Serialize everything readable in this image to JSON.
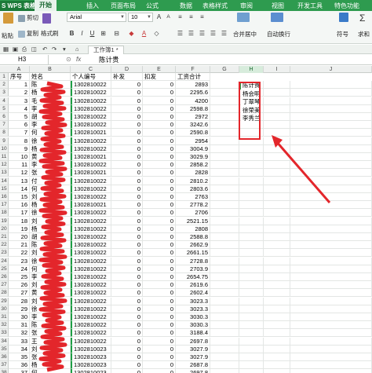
{
  "menubar": {
    "app_name": "S WPS 表格",
    "tabs": [
      "开始",
      "插入",
      "页面布局",
      "公式",
      "数据",
      "表格样式",
      "审阅",
      "视图",
      "开发工具",
      "特色功能"
    ],
    "active_tab": "开始"
  },
  "ribbon": {
    "cut": "剪切",
    "paste": "粘贴",
    "copy": "复制",
    "format_painter": "格式刷",
    "font_name": "Arial",
    "font_size": "10",
    "merge": "合并居中",
    "wrap": "自动换行",
    "symbol": "符号",
    "sum": "求和"
  },
  "tabbar": {
    "doc_tab": "工作簿1 *"
  },
  "formula_bar": {
    "name_box": "H3",
    "fx": "fx",
    "value": "陈计贵"
  },
  "columns": [
    "A",
    "B",
    "C",
    "D",
    "E",
    "F",
    "G",
    "H",
    "I",
    "J"
  ],
  "selected_column": "H",
  "header_row": {
    "row": "1",
    "cells": [
      "序号",
      "姓名",
      "个人编号",
      "补发",
      "扣发",
      "工资合计"
    ]
  },
  "rows": [
    {
      "r": "2",
      "a": "1",
      "b": "陈",
      "c": "1302810022",
      "d": "0",
      "e": "0",
      "f": "2893"
    },
    {
      "r": "3",
      "a": "2",
      "b": "杨",
      "c": "1302810022",
      "d": "0",
      "e": "0",
      "f": "2295.6"
    },
    {
      "r": "4",
      "a": "3",
      "b": "毛",
      "c": "1302810022",
      "d": "0",
      "e": "0",
      "f": "4200"
    },
    {
      "r": "5",
      "a": "4",
      "b": "李",
      "c": "1302810022",
      "d": "0",
      "e": "0",
      "f": "2598.8"
    },
    {
      "r": "6",
      "a": "5",
      "b": "胡",
      "c": "1302810022",
      "d": "0",
      "e": "0",
      "f": "2972"
    },
    {
      "r": "7",
      "a": "6",
      "b": "李",
      "c": "1302810022",
      "d": "0",
      "e": "0",
      "f": "3242.6"
    },
    {
      "r": "8",
      "a": "7",
      "b": "何",
      "c": "1302810021",
      "d": "0",
      "e": "0",
      "f": "2590.8"
    },
    {
      "r": "9",
      "a": "8",
      "b": "徐",
      "c": "1302810022",
      "d": "0",
      "e": "0",
      "f": "2954"
    },
    {
      "r": "10",
      "a": "9",
      "b": "杨",
      "c": "1302810022",
      "d": "0",
      "e": "0",
      "f": "3004.9"
    },
    {
      "r": "11",
      "a": "10",
      "b": "黄",
      "c": "1302810021",
      "d": "0",
      "e": "0",
      "f": "3029.9"
    },
    {
      "r": "12",
      "a": "11",
      "b": "李",
      "c": "1302810022",
      "d": "0",
      "e": "0",
      "f": "2858.2"
    },
    {
      "r": "13",
      "a": "12",
      "b": "张",
      "c": "1302810021",
      "d": "0",
      "e": "0",
      "f": "2828"
    },
    {
      "r": "14",
      "a": "13",
      "b": "付",
      "c": "1302810022",
      "d": "0",
      "e": "0",
      "f": "2810.2"
    },
    {
      "r": "15",
      "a": "14",
      "b": "何",
      "c": "1302810022",
      "d": "0",
      "e": "0",
      "f": "2803.6"
    },
    {
      "r": "16",
      "a": "15",
      "b": "刘",
      "c": "1302810022",
      "d": "0",
      "e": "0",
      "f": "2763"
    },
    {
      "r": "17",
      "a": "16",
      "b": "杨",
      "c": "1302810021",
      "d": "0",
      "e": "0",
      "f": "2778.2"
    },
    {
      "r": "18",
      "a": "17",
      "b": "徐",
      "c": "1302810022",
      "d": "0",
      "e": "0",
      "f": "2706"
    },
    {
      "r": "19",
      "a": "18",
      "b": "刘",
      "c": "1302810022",
      "d": "0",
      "e": "0",
      "f": "2521.15"
    },
    {
      "r": "20",
      "a": "19",
      "b": "杨",
      "c": "1302810022",
      "d": "0",
      "e": "0",
      "f": "2808"
    },
    {
      "r": "21",
      "a": "20",
      "b": "胡",
      "c": "1302810022",
      "d": "0",
      "e": "0",
      "f": "2588.8"
    },
    {
      "r": "22",
      "a": "21",
      "b": "陈",
      "c": "1302810022",
      "d": "0",
      "e": "0",
      "f": "2662.9"
    },
    {
      "r": "23",
      "a": "22",
      "b": "刘",
      "c": "1302810022",
      "d": "0",
      "e": "0",
      "f": "2661.15"
    },
    {
      "r": "24",
      "a": "23",
      "b": "徐",
      "c": "1302810022",
      "d": "0",
      "e": "0",
      "f": "2728.8"
    },
    {
      "r": "25",
      "a": "24",
      "b": "何",
      "c": "1302810022",
      "d": "0",
      "e": "0",
      "f": "2703.9"
    },
    {
      "r": "26",
      "a": "25",
      "b": "李",
      "c": "1302810022",
      "d": "0",
      "e": "0",
      "f": "2654.75"
    },
    {
      "r": "27",
      "a": "26",
      "b": "刘",
      "c": "1302810022",
      "d": "0",
      "e": "0",
      "f": "2619.6"
    },
    {
      "r": "28",
      "a": "27",
      "b": "黄",
      "c": "1302810022",
      "d": "0",
      "e": "0",
      "f": "2602.4"
    },
    {
      "r": "29",
      "a": "28",
      "b": "刘",
      "c": "1302810022",
      "d": "0",
      "e": "0",
      "f": "3023.3"
    },
    {
      "r": "30",
      "a": "29",
      "b": "徐",
      "c": "1302810022",
      "d": "0",
      "e": "0",
      "f": "3023.3"
    },
    {
      "r": "31",
      "a": "30",
      "b": "李",
      "c": "1302810022",
      "d": "0",
      "e": "0",
      "f": "3030.3"
    },
    {
      "r": "32",
      "a": "31",
      "b": "陈",
      "c": "1302810022",
      "d": "0",
      "e": "0",
      "f": "3030.3"
    },
    {
      "r": "33",
      "a": "32",
      "b": "张",
      "c": "1302810022",
      "d": "0",
      "e": "0",
      "f": "3188.4"
    },
    {
      "r": "34",
      "a": "33",
      "b": "王",
      "c": "1302810022",
      "d": "0",
      "e": "0",
      "f": "2697.8"
    },
    {
      "r": "35",
      "a": "34",
      "b": "刘",
      "c": "1302810023",
      "d": "0",
      "e": "0",
      "f": "3027.9"
    },
    {
      "r": "36",
      "a": "35",
      "b": "张",
      "c": "1302810023",
      "d": "0",
      "e": "0",
      "f": "3027.9"
    },
    {
      "r": "37",
      "a": "36",
      "b": "杨",
      "c": "1302810023",
      "d": "0",
      "e": "0",
      "f": "2687.8"
    },
    {
      "r": "38",
      "a": "37",
      "b": "何",
      "c": "1302810023",
      "d": "0",
      "e": "0",
      "f": "2697.8"
    }
  ],
  "col_h": [
    "陈计贵",
    "杨会明",
    "丁翠琴",
    "徐荣美",
    "李秀兰"
  ],
  "colors": {
    "wps_green": "#2e9b4f",
    "annotation_red": "#e3262b"
  }
}
